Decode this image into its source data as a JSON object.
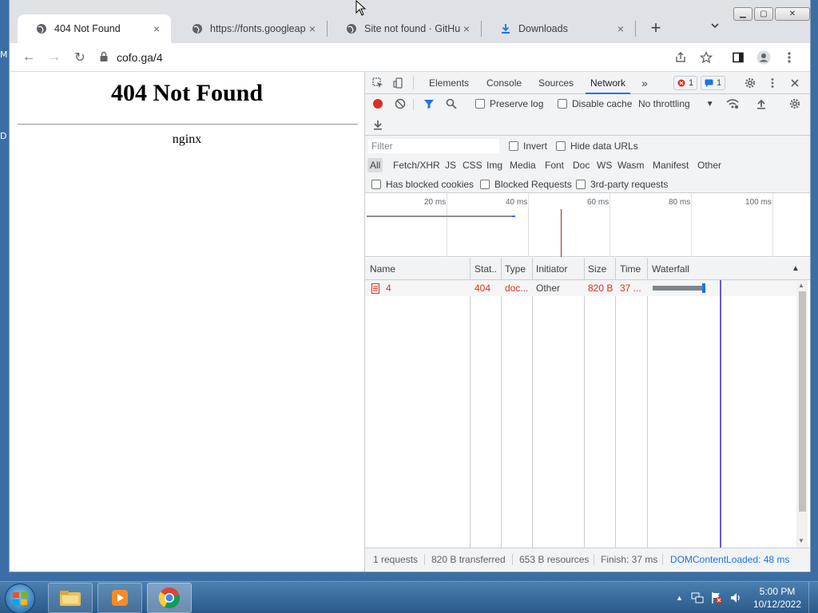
{
  "desktop": {
    "edge_letters": [
      "M",
      "D"
    ]
  },
  "window": {
    "tabs": [
      {
        "title": "404 Not Found",
        "active": true,
        "icon": "globe-icon"
      },
      {
        "title": "https://fonts.googleapis",
        "active": false,
        "icon": "globe-icon"
      },
      {
        "title": "Site not found · GitHub",
        "active": false,
        "icon": "globe-icon"
      },
      {
        "title": "Downloads",
        "active": false,
        "icon": "download-icon"
      }
    ],
    "close_glyph": "×",
    "newtab_glyph": "+",
    "tabsearch_glyph": "⌄",
    "controls": {
      "minimize": "▁",
      "maximize": "▢",
      "close": "✕"
    }
  },
  "toolbar": {
    "url": "cofo.ga/4",
    "back_glyph": "←",
    "forward_glyph": "→",
    "reload_glyph": "↻"
  },
  "page": {
    "heading": "404 Not Found",
    "server": "nginx"
  },
  "devtools": {
    "tabs": [
      "Elements",
      "Console",
      "Sources",
      "Network"
    ],
    "active_tab": "Network",
    "more_glyph": "»",
    "errors": "1",
    "messages": "1",
    "preserve_log": "Preserve log",
    "disable_cache": "Disable cache",
    "throttling": "No throttling",
    "filter_placeholder": "Filter",
    "invert": "Invert",
    "hide_data_urls": "Hide data URLs",
    "filter_types": [
      "All",
      "Fetch/XHR",
      "JS",
      "CSS",
      "Img",
      "Media",
      "Font",
      "Doc",
      "WS",
      "Wasm",
      "Manifest",
      "Other"
    ],
    "active_filter": "All",
    "has_blocked_cookies": "Has blocked cookies",
    "blocked_requests": "Blocked Requests",
    "third_party": "3rd-party requests",
    "overview_ticks": [
      "20 ms",
      "40 ms",
      "60 ms",
      "80 ms",
      "100 ms"
    ],
    "columns": [
      "Name",
      "Stat..",
      "Type",
      "Initiator",
      "Size",
      "Time",
      "Waterfall"
    ],
    "rows": [
      {
        "name": "4",
        "status": "404",
        "type": "doc...",
        "initiator": "Other",
        "size": "820 B",
        "time": "37 ..."
      }
    ],
    "status": {
      "requests": "1 requests",
      "transferred": "820 B transferred",
      "resources": "653 B resources",
      "finish": "Finish: 37 ms",
      "dcl": "DOMContentLoaded: 48 ms"
    }
  },
  "taskbar": {
    "time": "5:00 PM",
    "date": "10/12/2022"
  },
  "colors": {
    "accent": "#1a73e8",
    "error": "#d93025",
    "record": "#d93025",
    "taskbar": "#2a5a8a"
  }
}
